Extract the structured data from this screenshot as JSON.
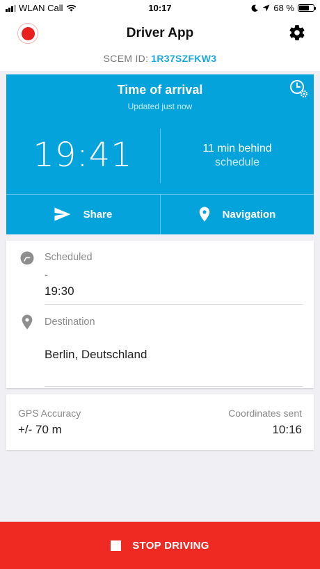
{
  "status_bar": {
    "carrier": "WLAN Call",
    "time": "10:17",
    "battery": "68 %",
    "battery_level": 0.68,
    "icons": [
      "signal-icon",
      "wifi-icon",
      "moon-icon",
      "location-arrow-icon",
      "battery-icon"
    ]
  },
  "header": {
    "title": "Driver App",
    "scem_label": "SCEM ID:",
    "scem_id": "1R37SZFKW3",
    "icons": [
      "record-icon",
      "gear-icon"
    ]
  },
  "arrival": {
    "title": "Time of arrival",
    "subtitle": "Updated just now",
    "eta": "19:41",
    "delay_line1": "11 min behind",
    "delay_line2": "schedule",
    "share_label": "Share",
    "navigation_label": "Navigation",
    "icons": [
      "clock-settings-icon",
      "send-icon",
      "map-pin-icon"
    ]
  },
  "details": {
    "scheduled_label": "Scheduled",
    "scheduled_dash": "-",
    "scheduled_value": "19:30",
    "destination_label": "Destination",
    "destination_value": "Berlin, Deutschland",
    "icons": [
      "clock-icon",
      "map-pin-icon"
    ]
  },
  "gps": {
    "accuracy_label": "GPS Accuracy",
    "accuracy_value": "+/- 70 m",
    "coords_label": "Coordinates sent",
    "coords_value": "10:16"
  },
  "footer": {
    "stop_label": "STOP DRIVING",
    "icons": [
      "stop-icon"
    ]
  },
  "colors": {
    "accent": "#04a3dc",
    "scem_id": "#1aa8dc",
    "record": "#e8201e",
    "stop": "#ee2a22",
    "background": "#efeff4"
  }
}
